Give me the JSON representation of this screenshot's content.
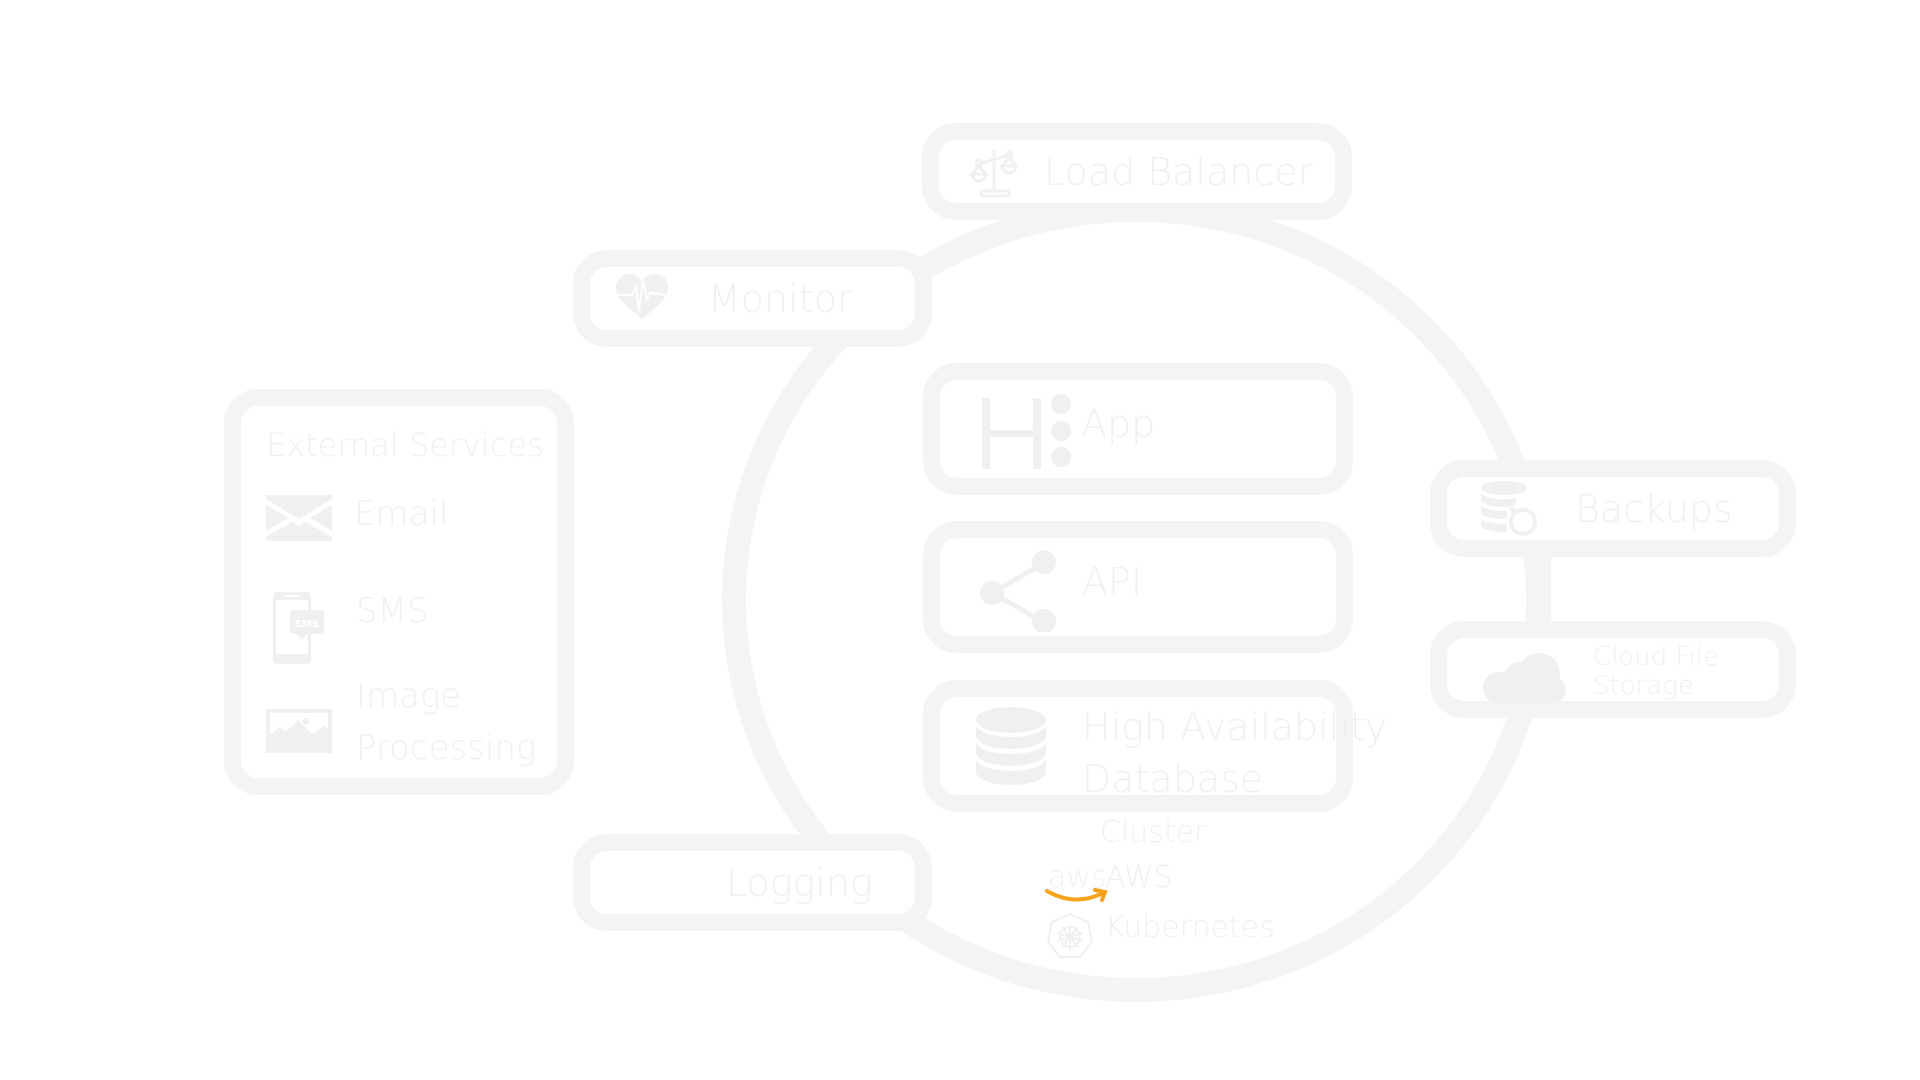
{
  "diagram": {
    "title": "Cluster",
    "colors": {
      "stroke": "#f4f4f4",
      "text": "#f0f0f0",
      "aws_accent": "#f7a21c",
      "background": "#ffffff"
    },
    "nodes": {
      "load_balancer": {
        "label": "Load Balancer",
        "icon": "balance-scale-icon"
      },
      "monitor": {
        "label": "Monitor",
        "icon": "heart-pulse-icon"
      },
      "logging": {
        "label": "Logging"
      },
      "app": {
        "label": "App",
        "icon": "heroku-icon"
      },
      "api": {
        "label": "API",
        "icon": "share-nodes-icon"
      },
      "database": {
        "label_line1": "High Availability",
        "label_line2": "Database",
        "icon": "database-icon"
      },
      "backups": {
        "label": "Backups",
        "icon": "database-restore-icon"
      },
      "cloud_storage": {
        "label_line1": "Cloud File",
        "label_line2": "Storage",
        "icon": "cloud-icon"
      }
    },
    "external_services": {
      "title": "External Services",
      "items": [
        {
          "label": "Email",
          "icon": "envelope-icon"
        },
        {
          "label": "SMS",
          "icon": "phone-sms-icon",
          "badge": "SMS"
        },
        {
          "label_line1": "Image",
          "label_line2": "Processing",
          "icon": "image-icon"
        }
      ]
    },
    "cluster": {
      "label": "Cluster",
      "provider_logo_text": "aws",
      "provider_label": "AWS",
      "orchestrator_label": "Kubernetes"
    }
  }
}
